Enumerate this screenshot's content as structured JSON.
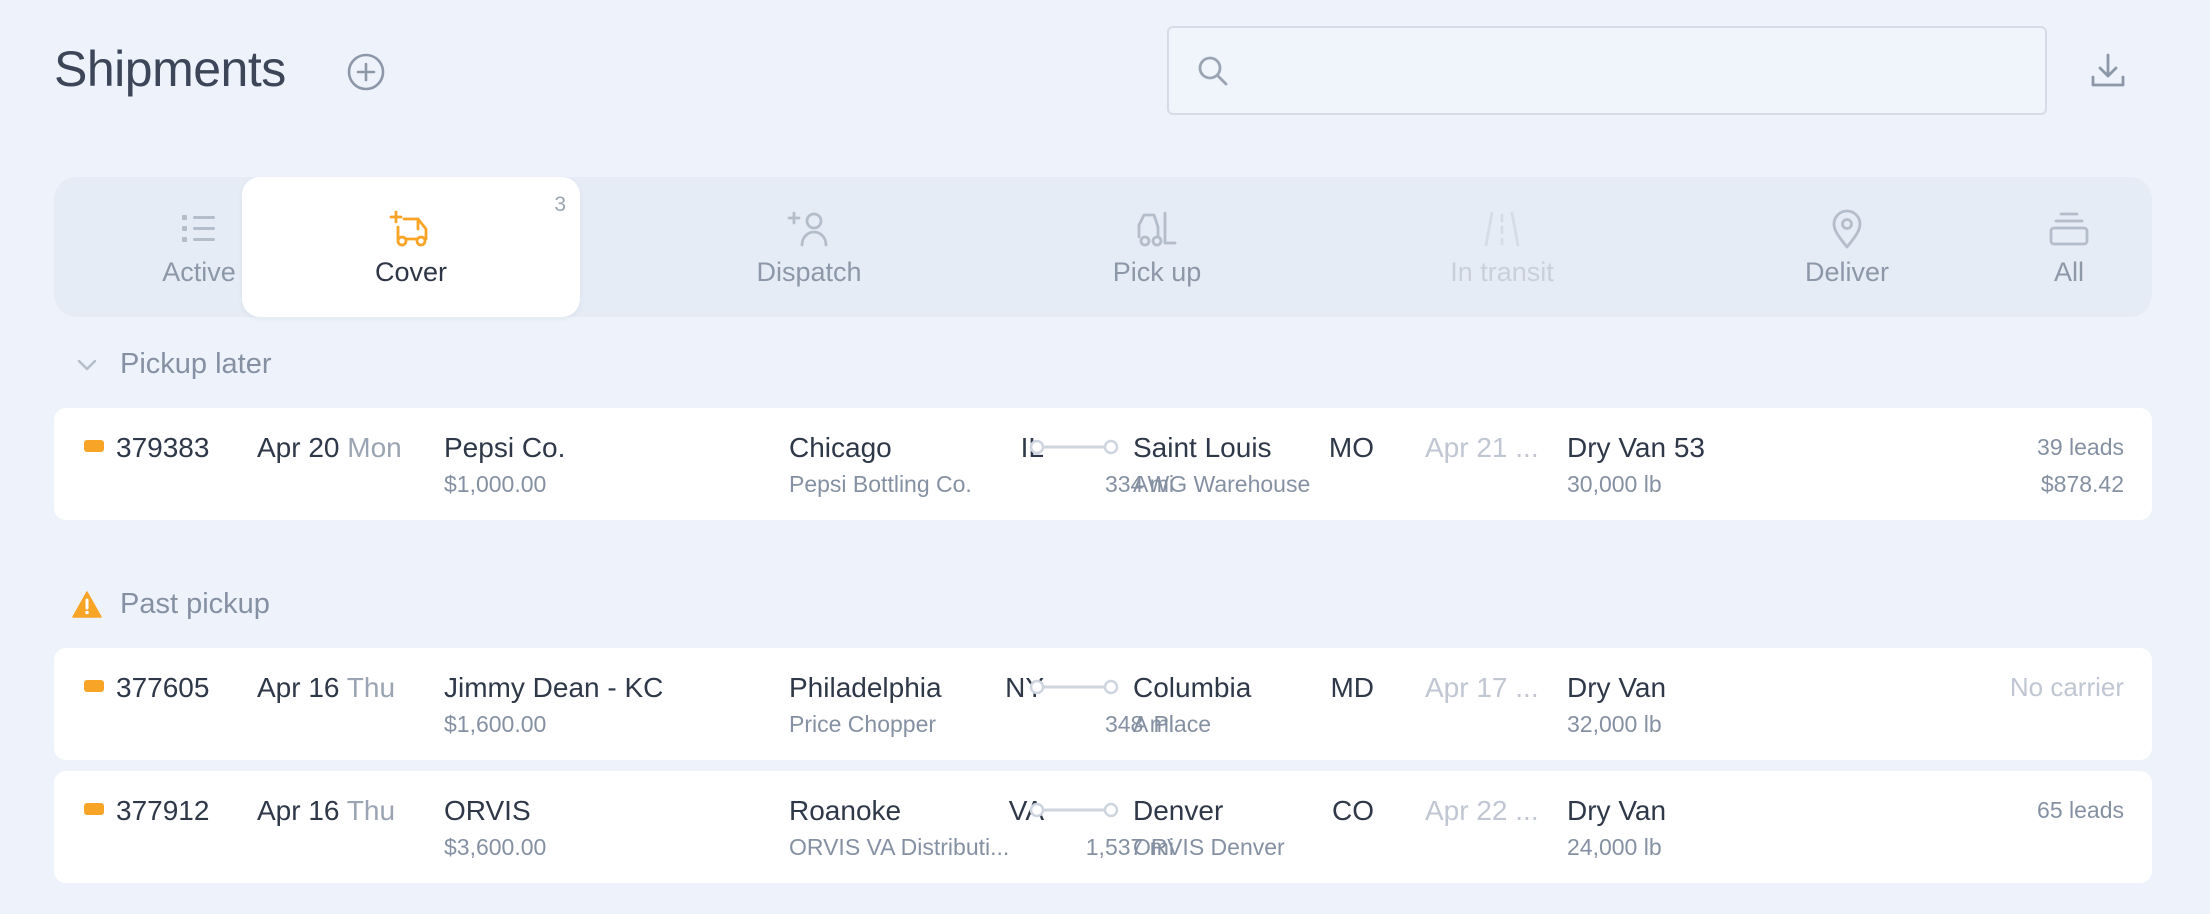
{
  "header": {
    "title": "Shipments",
    "search": {
      "value": "",
      "placeholder": ""
    }
  },
  "tabs": [
    {
      "label": "Active",
      "icon": "list-icon",
      "state": "default"
    },
    {
      "label": "Cover",
      "icon": "truck-plus-icon",
      "state": "active",
      "count": "3"
    },
    {
      "label": "Dispatch",
      "icon": "user-plus-icon",
      "state": "default"
    },
    {
      "label": "Pick up",
      "icon": "forklift-icon",
      "state": "default"
    },
    {
      "label": "In transit",
      "icon": "road-icon",
      "state": "disabled"
    },
    {
      "label": "Deliver",
      "icon": "map-pin-icon",
      "state": "default"
    },
    {
      "label": "All",
      "icon": "stack-icon",
      "state": "default"
    }
  ],
  "sections": [
    {
      "label": "Pickup later",
      "icon": "chevron-down-icon"
    },
    {
      "label": "Past pickup",
      "icon": "warning-icon"
    }
  ],
  "rows": [
    {
      "id": "379383",
      "date": "Apr 20",
      "weekday": "Mon",
      "customer": "Pepsi Co.",
      "rate": "$1,000.00",
      "origin_city": "Chicago",
      "origin_state": "IL",
      "origin_facility": "Pepsi Bottling Co.",
      "distance": "334",
      "distance_unit": "mi",
      "dest_city": "Saint Louis",
      "dest_state": "MO",
      "dest_facility": "AWG Warehouse",
      "delivery_date": "Apr 21 ...",
      "equipment": "Dry Van 53",
      "weight": "30,000 lb",
      "right_top": "39 leads",
      "right_bottom": "$878.42"
    },
    {
      "id": "377605",
      "date": "Apr 16",
      "weekday": "Thu",
      "customer": "Jimmy Dean - KC",
      "rate": "$1,600.00",
      "origin_city": "Philadelphia",
      "origin_state": "NY",
      "origin_facility": "Price Chopper",
      "distance": "348",
      "distance_unit": "mi",
      "dest_city": "Columbia",
      "dest_state": "MD",
      "dest_facility": "A Place",
      "delivery_date": "Apr 17 ...",
      "equipment": "Dry Van",
      "weight": "32,000 lb",
      "right_top": "No carrier",
      "right_bottom": ""
    },
    {
      "id": "377912",
      "date": "Apr 16",
      "weekday": "Thu",
      "customer": "ORVIS",
      "rate": "$3,600.00",
      "origin_city": "Roanoke",
      "origin_state": "VA",
      "origin_facility": "ORVIS VA Distributi...",
      "distance": "1,537",
      "distance_unit": "mi",
      "dest_city": "Denver",
      "dest_state": "CO",
      "dest_facility": "ORVIS Denver",
      "delivery_date": "Apr 22 ...",
      "equipment": "Dry Van",
      "weight": "24,000 lb",
      "right_top": "65 leads",
      "right_bottom": ""
    }
  ],
  "colors": {
    "accent": "#f7a427",
    "background": "#eef3fb",
    "icon_muted": "#9aa4b3"
  }
}
